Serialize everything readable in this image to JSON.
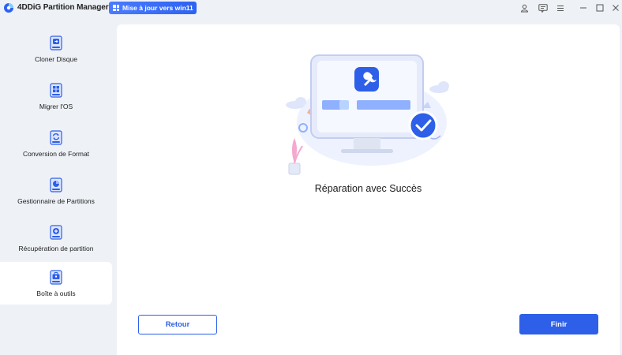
{
  "app": {
    "title": "4DDiG Partition Manager",
    "upgrade_label": "Mise à jour vers win11",
    "accent": "#2d5fe8"
  },
  "window_controls": {
    "icons": [
      "user-icon",
      "feedback-icon",
      "menu-icon",
      "minimize-icon",
      "maximize-icon",
      "close-icon"
    ]
  },
  "sidebar": {
    "items": [
      {
        "label": "Cloner Disque",
        "icon": "clone-disk-icon"
      },
      {
        "label": "Migrer l'OS",
        "icon": "migrate-os-icon"
      },
      {
        "label": "Conversion de Format",
        "icon": "format-conversion-icon"
      },
      {
        "label": "Gestionnaire de Partitions",
        "icon": "partition-manager-icon"
      },
      {
        "label": "Récupération de partition",
        "icon": "partition-recovery-icon"
      },
      {
        "label": "Boîte à outils",
        "icon": "toolbox-icon",
        "active": true
      }
    ]
  },
  "main": {
    "message": "Réparation avec Succès",
    "back_label": "Retour",
    "finish_label": "Finir"
  }
}
